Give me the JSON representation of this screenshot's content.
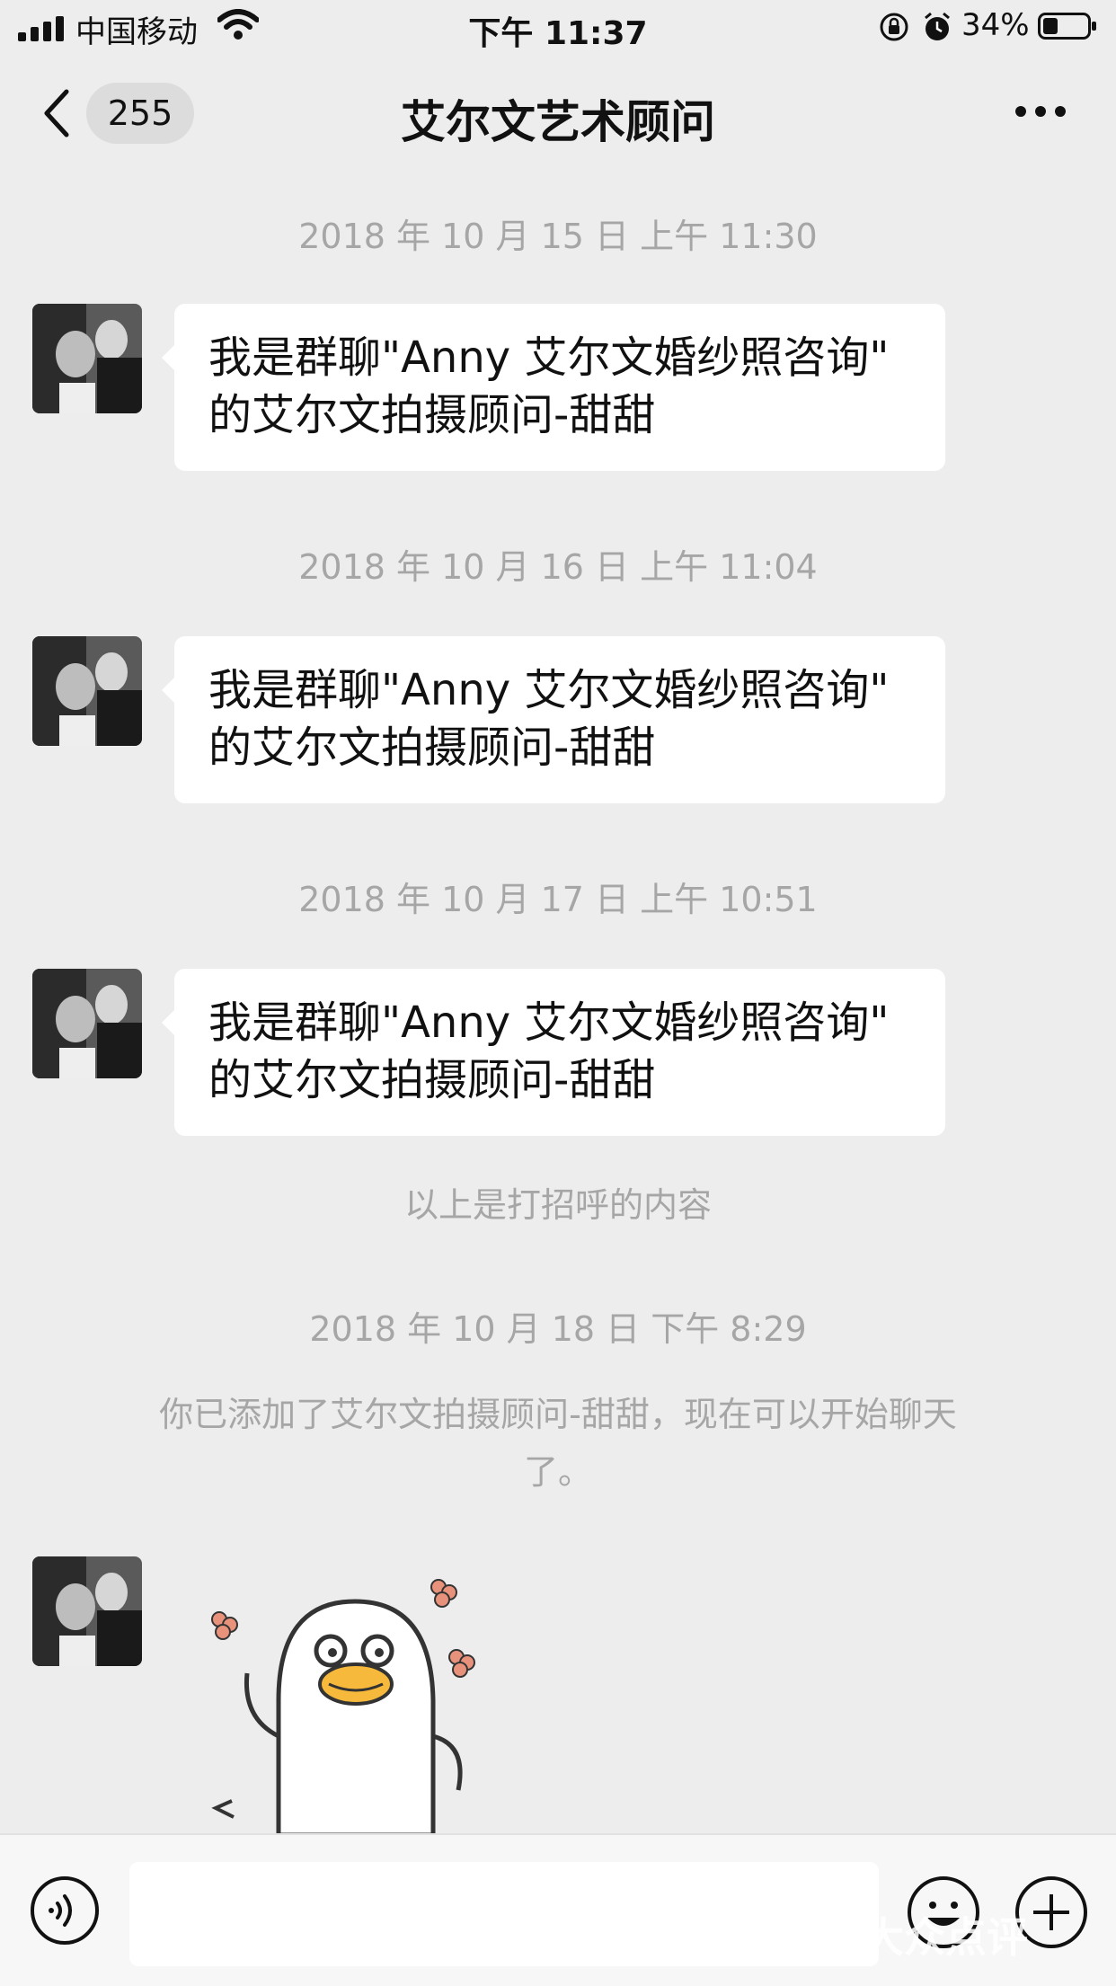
{
  "status_bar": {
    "carrier": "中国移动",
    "time": "下午 11:37",
    "battery_percent": "34%",
    "battery_level": 0.34
  },
  "nav": {
    "back_count": "255",
    "title": "艾尔文艺术顾问"
  },
  "messages": [
    {
      "timestamp": "2018 年 10 月 15 日 上午 11:30",
      "text": "我是群聊\"Anny 艾尔文婚纱照咨询\"\n的艾尔文拍摄顾问-甜甜"
    },
    {
      "timestamp": "2018 年 10 月 16 日 上午 11:04",
      "text": "我是群聊\"Anny 艾尔文婚纱照咨询\"\n的艾尔文拍摄顾问-甜甜"
    },
    {
      "timestamp": "2018 年 10 月 17 日 上午 10:51",
      "text": "我是群聊\"Anny 艾尔文婚纱照咨询\"\n的艾尔文拍摄顾问-甜甜"
    }
  ],
  "greeting_note": "以上是打招呼的内容",
  "added": {
    "timestamp": "2018 年 10 月 18 日 下午 8:29",
    "notice_line1": "你已添加了艾尔文拍摄顾问-甜甜，现在可以开始聊天",
    "notice_line2": "了。"
  },
  "sticker": {
    "icon": "duck-sticker"
  },
  "input_bar": {
    "voice_icon": "voice-icon",
    "emoji_icon": "emoji-icon",
    "plus_icon": "plus-icon"
  },
  "watermark": "大众点评"
}
